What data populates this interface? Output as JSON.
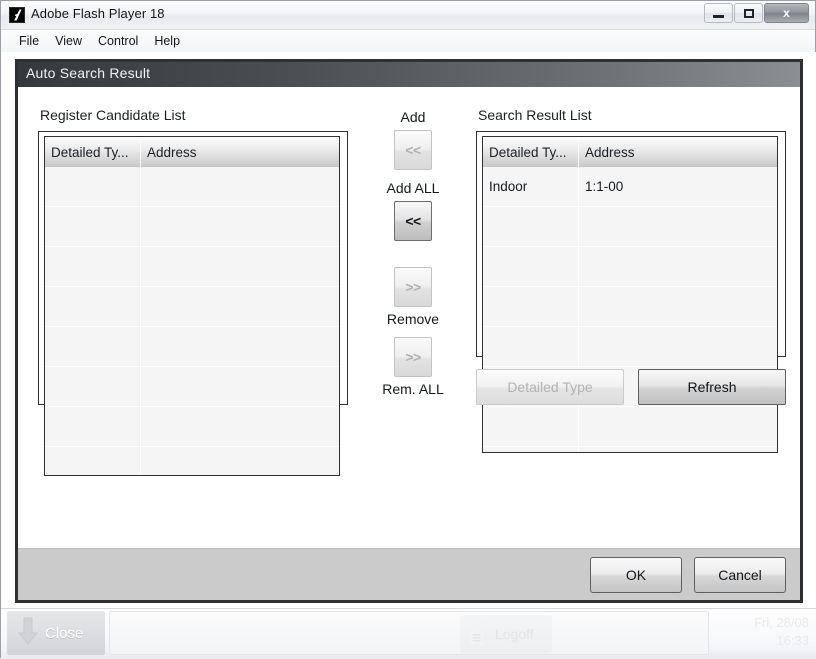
{
  "window": {
    "title": "Adobe Flash Player 18",
    "icon": "flash-logo-icon",
    "controls": {
      "minimize": "minimize-icon",
      "maximize": "maximize-icon",
      "close": "x"
    }
  },
  "menubar": {
    "items": [
      {
        "label": "File"
      },
      {
        "label": "View"
      },
      {
        "label": "Control"
      },
      {
        "label": "Help"
      }
    ]
  },
  "dialog": {
    "header_title": "Auto Search Result",
    "left_panel": {
      "label": "Register Candidate List",
      "columns": [
        "Detailed Ty...",
        "Address"
      ],
      "rows": []
    },
    "right_panel": {
      "label": "Search Result List",
      "columns": [
        "Detailed Ty...",
        "Address"
      ],
      "rows": [
        {
          "detailed_type": "Indoor",
          "address": "1:1-00"
        }
      ]
    },
    "transfer": {
      "add_label": "Add",
      "add_button": "<<",
      "add_all_label": "Add ALL",
      "add_all_button": "<<",
      "remove_label": "Remove",
      "remove_button": ">>",
      "remove_all_label": "Rem. ALL",
      "remove_all_button": ">>"
    },
    "actions": {
      "detailed_type": "Detailed Type",
      "refresh": "Refresh",
      "ok": "OK",
      "cancel": "Cancel"
    }
  },
  "statusbar": {
    "close_label": "Close",
    "close_icon": "down-arrow-icon",
    "logoff_label": "Logoff",
    "logoff_icon": "open-padlock-icon",
    "date": "Fri, 28/08",
    "time": "16:33"
  }
}
